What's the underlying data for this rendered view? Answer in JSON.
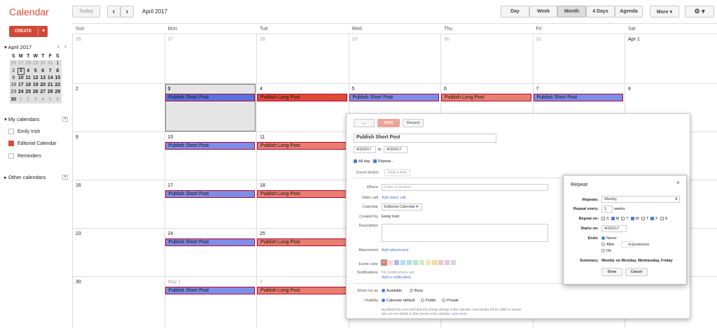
{
  "app": {
    "title": "Calendar"
  },
  "toolbar": {
    "today": "Today",
    "prev": "‹",
    "next": "›",
    "period": "April 2017",
    "views": [
      "Day",
      "Week",
      "Month",
      "4 Days",
      "Agenda"
    ],
    "more": "More ▾",
    "settings": "⚙ ▾"
  },
  "create": {
    "label": "CREATE",
    "caret": "▾"
  },
  "mini_cal": {
    "title": "April 2017",
    "prev": "‹",
    "next": "›",
    "weekdays": [
      "S",
      "M",
      "T",
      "W",
      "T",
      "F",
      "S"
    ],
    "weeks": [
      [
        "26",
        "27",
        "28",
        "29",
        "30",
        "31",
        "1"
      ],
      [
        "2",
        "3",
        "4",
        "5",
        "6",
        "7",
        "8"
      ],
      [
        "9",
        "10",
        "11",
        "12",
        "13",
        "14",
        "15"
      ],
      [
        "16",
        "17",
        "18",
        "19",
        "20",
        "21",
        "22"
      ],
      [
        "23",
        "24",
        "25",
        "26",
        "27",
        "28",
        "29"
      ],
      [
        "30",
        "1",
        "2",
        "3",
        "4",
        "5",
        "6"
      ]
    ]
  },
  "sidebar": {
    "my_calendars": "My calendars",
    "other_calendars": "Other calendars",
    "calendars": [
      "Emily Irish",
      "Editorial Calendar",
      "Reminders"
    ],
    "calendar_colors": [
      "",
      "#dd4b39",
      ""
    ]
  },
  "grid": {
    "weekdays": [
      "Sun",
      "Mon",
      "Tue",
      "Wed",
      "Thu",
      "Fri",
      "Sat"
    ],
    "weeks": [
      [
        "26",
        "27",
        "28",
        "29",
        "30",
        "31",
        "Apr 1"
      ],
      [
        "2",
        "3",
        "4",
        "5",
        "6",
        "7",
        "8"
      ],
      [
        "9",
        "10",
        "11",
        "12",
        "13",
        "14",
        "15"
      ],
      [
        "16",
        "17",
        "18",
        "19",
        "20",
        "21",
        "22"
      ],
      [
        "23",
        "24",
        "25",
        "26",
        "27",
        "28",
        "29"
      ],
      [
        "30",
        "May 1",
        "2",
        "3",
        "4",
        "5",
        "6"
      ]
    ],
    "events": [
      {
        "week": 1,
        "day": 1,
        "title": "Publish Short Post",
        "color": "bluedark"
      },
      {
        "week": 1,
        "day": 2,
        "title": "Publish Long Post",
        "color": "red"
      },
      {
        "week": 1,
        "day": 3,
        "title": "Publish Short Post",
        "color": "blue"
      },
      {
        "week": 1,
        "day": 4,
        "title": "Publish Long Post",
        "color": "salmon"
      },
      {
        "week": 1,
        "day": 5,
        "title": "Publish Short Post",
        "color": "blue"
      },
      {
        "week": 2,
        "day": 1,
        "title": "Publish Short Post",
        "color": "blue"
      },
      {
        "week": 2,
        "day": 2,
        "title": "Publish Long Post",
        "color": "salmon"
      },
      {
        "week": 3,
        "day": 1,
        "title": "Publish Short Post",
        "color": "blue"
      },
      {
        "week": 3,
        "day": 2,
        "title": "Publish Long Post",
        "color": "salmon"
      },
      {
        "week": 4,
        "day": 1,
        "title": "Publish Short Post",
        "color": "blue"
      },
      {
        "week": 4,
        "day": 2,
        "title": "Publish Long Post",
        "color": "salmon"
      },
      {
        "week": 5,
        "day": 1,
        "title": "Publish Short Post",
        "color": "blue"
      },
      {
        "week": 5,
        "day": 2,
        "title": "Publish Long Post",
        "color": "salmon"
      }
    ]
  },
  "editor": {
    "back": "←",
    "save": "SAVE",
    "discard": "Discard",
    "title": "Publish Short Post",
    "start": "4/3/2017",
    "to": "to",
    "end": "4/3/2017",
    "all_day": "All day",
    "repeat": "Repeat...",
    "tab_details": "Event details",
    "tab_find": "Find a time",
    "where_label": "Where",
    "where_placeholder": "Enter a location",
    "video_label": "Video call",
    "video_link": "Add video call",
    "calendar_label": "Calendar",
    "calendar_value": "Editorial Calendar ▾",
    "created_label": "Created by",
    "created_value": "Emily Irish",
    "desc_label": "Description",
    "attach_label": "Attachment",
    "attach_link": "Add attachment",
    "color_label": "Event color",
    "notif_label": "Notifications",
    "notif_none": "No notifications set",
    "notif_add": "Add a notification",
    "show_label": "Show me as",
    "show_options": [
      "Available",
      "Busy"
    ],
    "vis_label": "Visibility",
    "vis_options": [
      "Calendar default",
      "Public",
      "Private"
    ],
    "footnote1": "By default this event will follow the sharing settings of this calendar: event details will be visible to anyone",
    "footnote2": "who can see details of other events in this calendar.",
    "learn_more": "Learn more",
    "swatches": [
      "#e87f6e",
      "#fbd7cf",
      "#a8b8f0",
      "#b8d8f5",
      "#a9e0e8",
      "#b8e8c8",
      "#c9f0c0",
      "#f0e8a8",
      "#f8d8a8",
      "#f8c8b8",
      "#e8c0f0",
      "#d8d8d8"
    ]
  },
  "repeat": {
    "title": "Repeat",
    "close": "×",
    "repeats_label": "Repeats:",
    "repeats_value": "Weekly",
    "every_label": "Repeat every:",
    "every_value": "1",
    "every_unit": "weeks",
    "on_label": "Repeat on:",
    "days": [
      "S",
      "M",
      "T",
      "W",
      "T",
      "F",
      "S"
    ],
    "days_checked": [
      false,
      true,
      false,
      true,
      false,
      true,
      false
    ],
    "starts_label": "Starts on:",
    "starts_value": "4/3/2017",
    "ends_label": "Ends:",
    "ends_options": [
      "Never",
      "After",
      "On"
    ],
    "occurrences": "occurrences",
    "summary_label": "Summary:",
    "summary_value": "Weekly on Monday, Wednesday, Friday",
    "done": "Done",
    "cancel": "Cancel"
  }
}
